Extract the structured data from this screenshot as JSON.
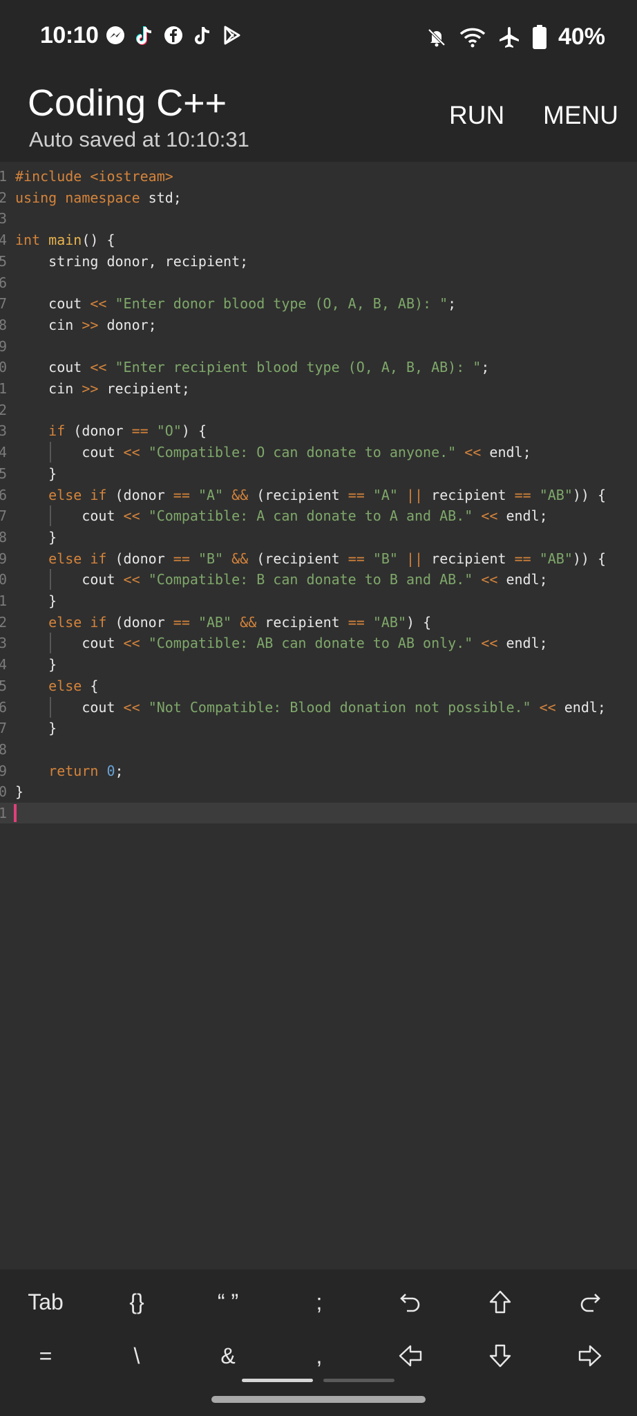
{
  "status_bar": {
    "time": "10:10",
    "battery": "40%",
    "notification_icons": [
      "messenger-icon",
      "tiktok-icon",
      "facebook-icon",
      "tiktok-icon",
      "play-store-icon"
    ],
    "system_icons": [
      "bell-off-icon",
      "wifi-icon",
      "airplane-icon",
      "battery-icon"
    ]
  },
  "header": {
    "title": "Coding C++",
    "subtitle": "Auto saved at 10:10:31",
    "run_label": "RUN",
    "menu_label": "MENU"
  },
  "editor": {
    "active_line": 31,
    "lines": [
      [
        [
          "pre",
          "#include <iostream>"
        ]
      ],
      [
        [
          "kw",
          "using namespace "
        ],
        [
          "p",
          "std;"
        ]
      ],
      [],
      [
        [
          "kw",
          "int "
        ],
        [
          "fn",
          "main"
        ],
        [
          "p",
          "() {"
        ]
      ],
      [
        [
          "p",
          "    string donor, recipient;"
        ]
      ],
      [],
      [
        [
          "p",
          "    cout "
        ],
        [
          "op",
          "<<"
        ],
        [
          "p",
          " "
        ],
        [
          "str",
          "\"Enter donor blood type (O, A, B, AB): \""
        ],
        [
          "p",
          ";"
        ]
      ],
      [
        [
          "p",
          "    cin "
        ],
        [
          "op",
          ">>"
        ],
        [
          "p",
          " donor;"
        ]
      ],
      [],
      [
        [
          "p",
          "    cout "
        ],
        [
          "op",
          "<<"
        ],
        [
          "p",
          " "
        ],
        [
          "str",
          "\"Enter recipient blood type (O, A, B, AB): \""
        ],
        [
          "p",
          ";"
        ]
      ],
      [
        [
          "p",
          "    cin "
        ],
        [
          "op",
          ">>"
        ],
        [
          "p",
          " recipient;"
        ]
      ],
      [],
      [
        [
          "p",
          "    "
        ],
        [
          "kw",
          "if"
        ],
        [
          "p",
          " (donor "
        ],
        [
          "op",
          "=="
        ],
        [
          "p",
          " "
        ],
        [
          "str",
          "\"O\""
        ],
        [
          "p",
          ") {"
        ]
      ],
      [
        [
          "p",
          "        cout "
        ],
        [
          "op",
          "<<"
        ],
        [
          "p",
          " "
        ],
        [
          "str",
          "\"Compatible: O can donate to anyone.\""
        ],
        [
          "p",
          " "
        ],
        [
          "op",
          "<<"
        ],
        [
          "p",
          " endl;"
        ]
      ],
      [
        [
          "p",
          "    }"
        ]
      ],
      [
        [
          "p",
          "    "
        ],
        [
          "kw",
          "else if"
        ],
        [
          "p",
          " (donor "
        ],
        [
          "op",
          "=="
        ],
        [
          "p",
          " "
        ],
        [
          "str",
          "\"A\""
        ],
        [
          "p",
          " "
        ],
        [
          "op",
          "&&"
        ],
        [
          "p",
          " (recipient "
        ],
        [
          "op",
          "=="
        ],
        [
          "p",
          " "
        ],
        [
          "str",
          "\"A\""
        ],
        [
          "p",
          " "
        ],
        [
          "op",
          "||"
        ],
        [
          "p",
          " recipient "
        ],
        [
          "op",
          "=="
        ],
        [
          "p",
          " "
        ],
        [
          "str",
          "\"AB\""
        ],
        [
          "p",
          ")) {"
        ]
      ],
      [
        [
          "p",
          "        cout "
        ],
        [
          "op",
          "<<"
        ],
        [
          "p",
          " "
        ],
        [
          "str",
          "\"Compatible: A can donate to A and AB.\""
        ],
        [
          "p",
          " "
        ],
        [
          "op",
          "<<"
        ],
        [
          "p",
          " endl;"
        ]
      ],
      [
        [
          "p",
          "    }"
        ]
      ],
      [
        [
          "p",
          "    "
        ],
        [
          "kw",
          "else if"
        ],
        [
          "p",
          " (donor "
        ],
        [
          "op",
          "=="
        ],
        [
          "p",
          " "
        ],
        [
          "str",
          "\"B\""
        ],
        [
          "p",
          " "
        ],
        [
          "op",
          "&&"
        ],
        [
          "p",
          " (recipient "
        ],
        [
          "op",
          "=="
        ],
        [
          "p",
          " "
        ],
        [
          "str",
          "\"B\""
        ],
        [
          "p",
          " "
        ],
        [
          "op",
          "||"
        ],
        [
          "p",
          " recipient "
        ],
        [
          "op",
          "=="
        ],
        [
          "p",
          " "
        ],
        [
          "str",
          "\"AB\""
        ],
        [
          "p",
          ")) {"
        ]
      ],
      [
        [
          "p",
          "        cout "
        ],
        [
          "op",
          "<<"
        ],
        [
          "p",
          " "
        ],
        [
          "str",
          "\"Compatible: B can donate to B and AB.\""
        ],
        [
          "p",
          " "
        ],
        [
          "op",
          "<<"
        ],
        [
          "p",
          " endl;"
        ]
      ],
      [
        [
          "p",
          "    }"
        ]
      ],
      [
        [
          "p",
          "    "
        ],
        [
          "kw",
          "else if"
        ],
        [
          "p",
          " (donor "
        ],
        [
          "op",
          "=="
        ],
        [
          "p",
          " "
        ],
        [
          "str",
          "\"AB\""
        ],
        [
          "p",
          " "
        ],
        [
          "op",
          "&&"
        ],
        [
          "p",
          " recipient "
        ],
        [
          "op",
          "=="
        ],
        [
          "p",
          " "
        ],
        [
          "str",
          "\"AB\""
        ],
        [
          "p",
          ") {"
        ]
      ],
      [
        [
          "p",
          "        cout "
        ],
        [
          "op",
          "<<"
        ],
        [
          "p",
          " "
        ],
        [
          "str",
          "\"Compatible: AB can donate to AB only.\""
        ],
        [
          "p",
          " "
        ],
        [
          "op",
          "<<"
        ],
        [
          "p",
          " endl;"
        ]
      ],
      [
        [
          "p",
          "    }"
        ]
      ],
      [
        [
          "p",
          "    "
        ],
        [
          "kw",
          "else"
        ],
        [
          "p",
          " {"
        ]
      ],
      [
        [
          "p",
          "        cout "
        ],
        [
          "op",
          "<<"
        ],
        [
          "p",
          " "
        ],
        [
          "str",
          "\"Not Compatible: Blood donation not possible.\""
        ],
        [
          "p",
          " "
        ],
        [
          "op",
          "<<"
        ],
        [
          "p",
          " endl;"
        ]
      ],
      [
        [
          "p",
          "    }"
        ]
      ],
      [],
      [
        [
          "p",
          "    "
        ],
        [
          "kw",
          "return "
        ],
        [
          "num",
          "0"
        ],
        [
          "p",
          ";"
        ]
      ],
      [
        [
          "p",
          "}"
        ]
      ],
      []
    ]
  },
  "extra_keys": {
    "row1": [
      {
        "name": "tab-key",
        "label": "Tab"
      },
      {
        "name": "braces-key",
        "label": "{}"
      },
      {
        "name": "quotes-key",
        "label": "“ ”"
      },
      {
        "name": "semicolon-key",
        "label": ";"
      },
      {
        "name": "undo-key",
        "icon": "undo-icon"
      },
      {
        "name": "shift-up-key",
        "icon": "arrow-up-icon"
      },
      {
        "name": "redo-key",
        "icon": "redo-icon"
      }
    ],
    "row2": [
      {
        "name": "equals-key",
        "label": "="
      },
      {
        "name": "backslash-key",
        "label": "\\"
      },
      {
        "name": "ampersand-key",
        "label": "&"
      },
      {
        "name": "comma-key",
        "label": ","
      },
      {
        "name": "left-arrow-key",
        "icon": "arrow-left-icon"
      },
      {
        "name": "down-arrow-key",
        "icon": "arrow-down-icon"
      },
      {
        "name": "right-arrow-key",
        "icon": "arrow-right-icon"
      }
    ]
  },
  "colors": {
    "background": "#2f2f2f",
    "header": "#262626",
    "keyword": "#d5843b",
    "string": "#7fa86a",
    "number": "#6aa3d6",
    "cursor": "#e0407a"
  }
}
